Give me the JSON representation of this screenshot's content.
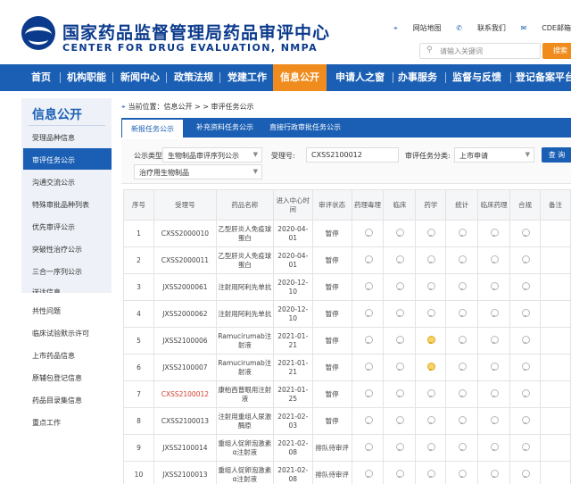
{
  "header": {
    "title_cn": "国家药品监督管理局药品审评中心",
    "title_en": "CENTER FOR DRUG EVALUATION, NMPA",
    "links": [
      {
        "icon": "location-pin-icon",
        "label": "网站地图"
      },
      {
        "icon": "phone-icon",
        "label": "联系我们"
      },
      {
        "icon": "mail-icon",
        "label": "CDE邮箱"
      }
    ],
    "search_placeholder": "请输入关键词",
    "search_button": "搜索"
  },
  "nav": {
    "items": [
      "首页",
      "机构职能",
      "新闻中心",
      "政策法规",
      "党建工作",
      "信息公开",
      "申请人之窗",
      "办事服务",
      "监督与反馈",
      "登记备案平台"
    ],
    "active_index": 5
  },
  "sidebar": {
    "title": "信息公开",
    "items": [
      "受理品种信息",
      "审评任务公示",
      "沟通交流公示",
      "特殊审批品种列表",
      "优先审评公示",
      "突破性治疗公示",
      "三合一序列公示",
      "送达信息",
      "共性问题",
      "临床试验默示许可",
      "上市药品信息",
      "原辅包登记信息",
      "药品目录集信息",
      "重点工作"
    ],
    "active_index": 1
  },
  "breadcrumb": {
    "prefix": "当前位置：",
    "path": "信息公开 > > 审评任务公示"
  },
  "tabs": {
    "items": [
      "新报任务公示",
      "补充资料任务公示",
      "直接行政审批任务公示"
    ],
    "active_index": 0
  },
  "filters": {
    "category_label": "公示类型:",
    "category_value": "生物制品审评序列公示",
    "accept_no_label": "受理号:",
    "accept_no_value": "CXSS2100012",
    "task_type_label": "审评任务分类:",
    "task_type_value": "上市申请",
    "sub_category_value": "治疗用生物制品",
    "query_button": "查 询"
  },
  "table": {
    "headers": [
      "序号",
      "受理号",
      "药品名称",
      "进入中心时间",
      "审评状态",
      "药理毒理",
      "临床",
      "药学",
      "统计",
      "临床药理",
      "合规",
      "备注"
    ],
    "rows": [
      {
        "no": "1",
        "code": "CXSS2000010",
        "name": "乙型肝炎人免疫球蛋白",
        "date": "2020-04-01",
        "status": "暂停",
        "lights": [
          0,
          0,
          0,
          0,
          0,
          0
        ],
        "red": false
      },
      {
        "no": "2",
        "code": "CXSS2000011",
        "name": "乙型肝炎人免疫球蛋白",
        "date": "2020-04-01",
        "status": "暂停",
        "lights": [
          0,
          0,
          0,
          0,
          0,
          0
        ],
        "red": false
      },
      {
        "no": "3",
        "code": "JXSS2000061",
        "name": "注射用阿利先单抗",
        "date": "2020-12-10",
        "status": "暂停",
        "lights": [
          0,
          0,
          0,
          0,
          0,
          0
        ],
        "red": false
      },
      {
        "no": "4",
        "code": "JXSS2000062",
        "name": "注射用阿利先单抗",
        "date": "2020-12-10",
        "status": "暂停",
        "lights": [
          0,
          0,
          0,
          0,
          0,
          0
        ],
        "red": false
      },
      {
        "no": "5",
        "code": "JXSS2100006",
        "name": "Ramucirumab注射液",
        "date": "2021-01-21",
        "status": "暂停",
        "lights": [
          0,
          0,
          1,
          0,
          0,
          0
        ],
        "red": false
      },
      {
        "no": "6",
        "code": "JXSS2100007",
        "name": "Ramucirumab注射液",
        "date": "2021-01-21",
        "status": "暂停",
        "lights": [
          0,
          0,
          1,
          0,
          0,
          0
        ],
        "red": false
      },
      {
        "no": "7",
        "code": "CXSS2100012",
        "name": "康柏西普眼用注射液",
        "date": "2021-01-25",
        "status": "暂停",
        "lights": [
          0,
          0,
          0,
          0,
          0,
          0
        ],
        "red": true
      },
      {
        "no": "8",
        "code": "CXSS2100013",
        "name": "注射用重组人尿激酶原",
        "date": "2021-02-03",
        "status": "暂停",
        "lights": [
          0,
          0,
          0,
          0,
          0,
          0
        ],
        "red": false
      },
      {
        "no": "9",
        "code": "JXSS2100014",
        "name": "重组人促卵泡激素α注射液",
        "date": "2021-02-08",
        "status": "排队待审评",
        "lights": [
          0,
          0,
          0,
          0,
          0,
          0
        ],
        "red": false
      },
      {
        "no": "10",
        "code": "JXSS2100013",
        "name": "重组人促卵泡激素α注射液",
        "date": "2021-02-08",
        "status": "排队待审评",
        "lights": [
          0,
          0,
          0,
          0,
          0,
          0
        ],
        "red": false
      }
    ]
  },
  "colors": {
    "brand_blue": "#1a5fb4",
    "accent_orange": "#f08c1e",
    "highlight_red": "#d23c2b"
  }
}
